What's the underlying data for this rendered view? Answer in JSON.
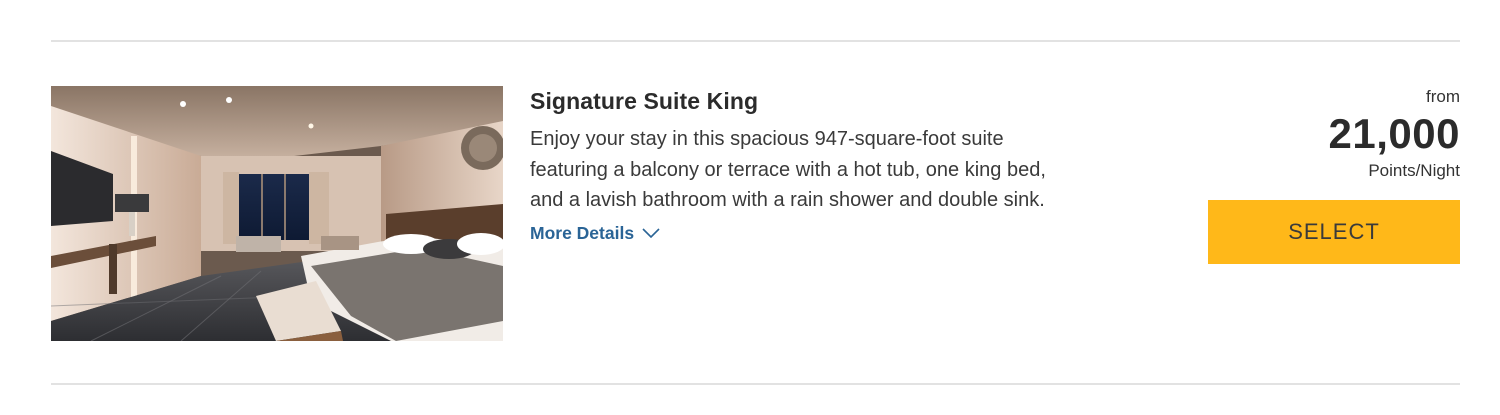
{
  "room": {
    "title": "Signature Suite King",
    "description": "Enjoy your stay in this spacious 947-square-foot suite featuring a balcony or terrace with a hot tub, one king bed, and a lavish bathroom with a rain shower and double sink.",
    "more_details_label": "More Details",
    "photo_alt": "Signature Suite King room photo"
  },
  "price": {
    "from_label": "from",
    "amount": "21,000",
    "unit_label": "Points/Night"
  },
  "actions": {
    "select_label": "SELECT"
  },
  "colors": {
    "select_button": "#ffb819",
    "link": "#2a6496",
    "divider": "#e2e2e2"
  }
}
